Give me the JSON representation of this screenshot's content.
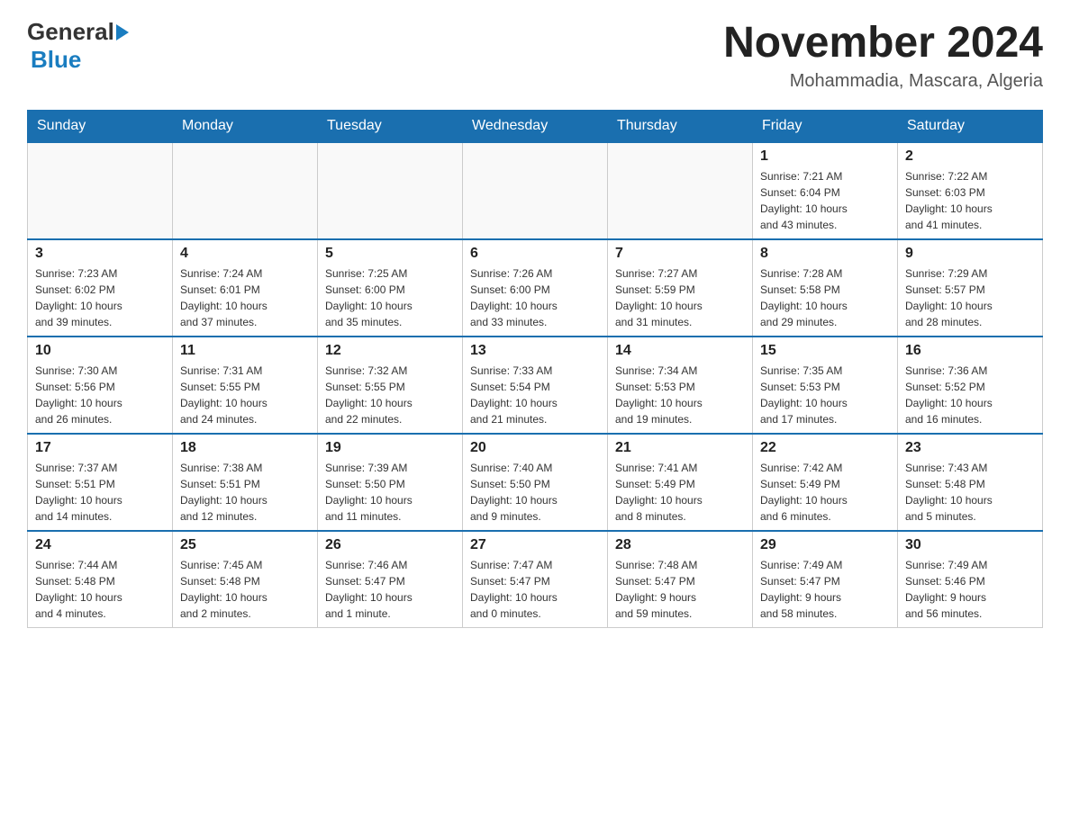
{
  "logo": {
    "general": "General",
    "blue": "Blue"
  },
  "title": "November 2024",
  "location": "Mohammadia, Mascara, Algeria",
  "days_header": [
    "Sunday",
    "Monday",
    "Tuesday",
    "Wednesday",
    "Thursday",
    "Friday",
    "Saturday"
  ],
  "weeks": [
    [
      {
        "num": "",
        "info": ""
      },
      {
        "num": "",
        "info": ""
      },
      {
        "num": "",
        "info": ""
      },
      {
        "num": "",
        "info": ""
      },
      {
        "num": "",
        "info": ""
      },
      {
        "num": "1",
        "info": "Sunrise: 7:21 AM\nSunset: 6:04 PM\nDaylight: 10 hours\nand 43 minutes."
      },
      {
        "num": "2",
        "info": "Sunrise: 7:22 AM\nSunset: 6:03 PM\nDaylight: 10 hours\nand 41 minutes."
      }
    ],
    [
      {
        "num": "3",
        "info": "Sunrise: 7:23 AM\nSunset: 6:02 PM\nDaylight: 10 hours\nand 39 minutes."
      },
      {
        "num": "4",
        "info": "Sunrise: 7:24 AM\nSunset: 6:01 PM\nDaylight: 10 hours\nand 37 minutes."
      },
      {
        "num": "5",
        "info": "Sunrise: 7:25 AM\nSunset: 6:00 PM\nDaylight: 10 hours\nand 35 minutes."
      },
      {
        "num": "6",
        "info": "Sunrise: 7:26 AM\nSunset: 6:00 PM\nDaylight: 10 hours\nand 33 minutes."
      },
      {
        "num": "7",
        "info": "Sunrise: 7:27 AM\nSunset: 5:59 PM\nDaylight: 10 hours\nand 31 minutes."
      },
      {
        "num": "8",
        "info": "Sunrise: 7:28 AM\nSunset: 5:58 PM\nDaylight: 10 hours\nand 29 minutes."
      },
      {
        "num": "9",
        "info": "Sunrise: 7:29 AM\nSunset: 5:57 PM\nDaylight: 10 hours\nand 28 minutes."
      }
    ],
    [
      {
        "num": "10",
        "info": "Sunrise: 7:30 AM\nSunset: 5:56 PM\nDaylight: 10 hours\nand 26 minutes."
      },
      {
        "num": "11",
        "info": "Sunrise: 7:31 AM\nSunset: 5:55 PM\nDaylight: 10 hours\nand 24 minutes."
      },
      {
        "num": "12",
        "info": "Sunrise: 7:32 AM\nSunset: 5:55 PM\nDaylight: 10 hours\nand 22 minutes."
      },
      {
        "num": "13",
        "info": "Sunrise: 7:33 AM\nSunset: 5:54 PM\nDaylight: 10 hours\nand 21 minutes."
      },
      {
        "num": "14",
        "info": "Sunrise: 7:34 AM\nSunset: 5:53 PM\nDaylight: 10 hours\nand 19 minutes."
      },
      {
        "num": "15",
        "info": "Sunrise: 7:35 AM\nSunset: 5:53 PM\nDaylight: 10 hours\nand 17 minutes."
      },
      {
        "num": "16",
        "info": "Sunrise: 7:36 AM\nSunset: 5:52 PM\nDaylight: 10 hours\nand 16 minutes."
      }
    ],
    [
      {
        "num": "17",
        "info": "Sunrise: 7:37 AM\nSunset: 5:51 PM\nDaylight: 10 hours\nand 14 minutes."
      },
      {
        "num": "18",
        "info": "Sunrise: 7:38 AM\nSunset: 5:51 PM\nDaylight: 10 hours\nand 12 minutes."
      },
      {
        "num": "19",
        "info": "Sunrise: 7:39 AM\nSunset: 5:50 PM\nDaylight: 10 hours\nand 11 minutes."
      },
      {
        "num": "20",
        "info": "Sunrise: 7:40 AM\nSunset: 5:50 PM\nDaylight: 10 hours\nand 9 minutes."
      },
      {
        "num": "21",
        "info": "Sunrise: 7:41 AM\nSunset: 5:49 PM\nDaylight: 10 hours\nand 8 minutes."
      },
      {
        "num": "22",
        "info": "Sunrise: 7:42 AM\nSunset: 5:49 PM\nDaylight: 10 hours\nand 6 minutes."
      },
      {
        "num": "23",
        "info": "Sunrise: 7:43 AM\nSunset: 5:48 PM\nDaylight: 10 hours\nand 5 minutes."
      }
    ],
    [
      {
        "num": "24",
        "info": "Sunrise: 7:44 AM\nSunset: 5:48 PM\nDaylight: 10 hours\nand 4 minutes."
      },
      {
        "num": "25",
        "info": "Sunrise: 7:45 AM\nSunset: 5:48 PM\nDaylight: 10 hours\nand 2 minutes."
      },
      {
        "num": "26",
        "info": "Sunrise: 7:46 AM\nSunset: 5:47 PM\nDaylight: 10 hours\nand 1 minute."
      },
      {
        "num": "27",
        "info": "Sunrise: 7:47 AM\nSunset: 5:47 PM\nDaylight: 10 hours\nand 0 minutes."
      },
      {
        "num": "28",
        "info": "Sunrise: 7:48 AM\nSunset: 5:47 PM\nDaylight: 9 hours\nand 59 minutes."
      },
      {
        "num": "29",
        "info": "Sunrise: 7:49 AM\nSunset: 5:47 PM\nDaylight: 9 hours\nand 58 minutes."
      },
      {
        "num": "30",
        "info": "Sunrise: 7:49 AM\nSunset: 5:46 PM\nDaylight: 9 hours\nand 56 minutes."
      }
    ]
  ]
}
